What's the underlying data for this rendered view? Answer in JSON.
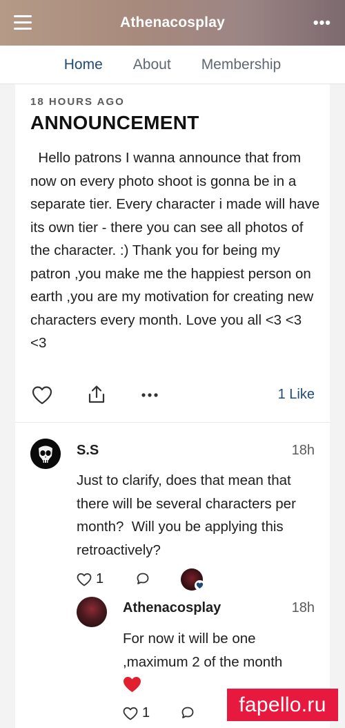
{
  "header": {
    "title": "Athenacosplay"
  },
  "tabs": [
    {
      "label": "Home",
      "active": true
    },
    {
      "label": "About",
      "active": false
    },
    {
      "label": "Membership",
      "active": false
    }
  ],
  "post": {
    "time": "18 HOURS AGO",
    "title": "ANNOUNCEMENT",
    "body": "  Hello patrons I wanna announce that from now on every photo shoot is gonna be in a separate tier. Every character i made will have its own tier - there you can see all photos of the character. :) Thank you for being my patron ,you make me the happiest person on earth ,you are my motivation for creating new characters every month. Love you all <3 <3 <3",
    "likes_label": "1 Like"
  },
  "comments": [
    {
      "author": "S.S",
      "time": "18h",
      "text": "Just to clarify, does that mean that there will be several characters per month?  Will you be applying this retroactively?",
      "like_count": "1"
    }
  ],
  "reply": {
    "author": "Athenacosplay",
    "time": "18h",
    "text": "For now it will be one ,maximum 2 of the month",
    "like_count": "1"
  },
  "watermark": "fapello.ru",
  "colors": {
    "accent": "#1f4a75",
    "heart": "#e0202f",
    "watermark_bg": "#e8193e"
  }
}
